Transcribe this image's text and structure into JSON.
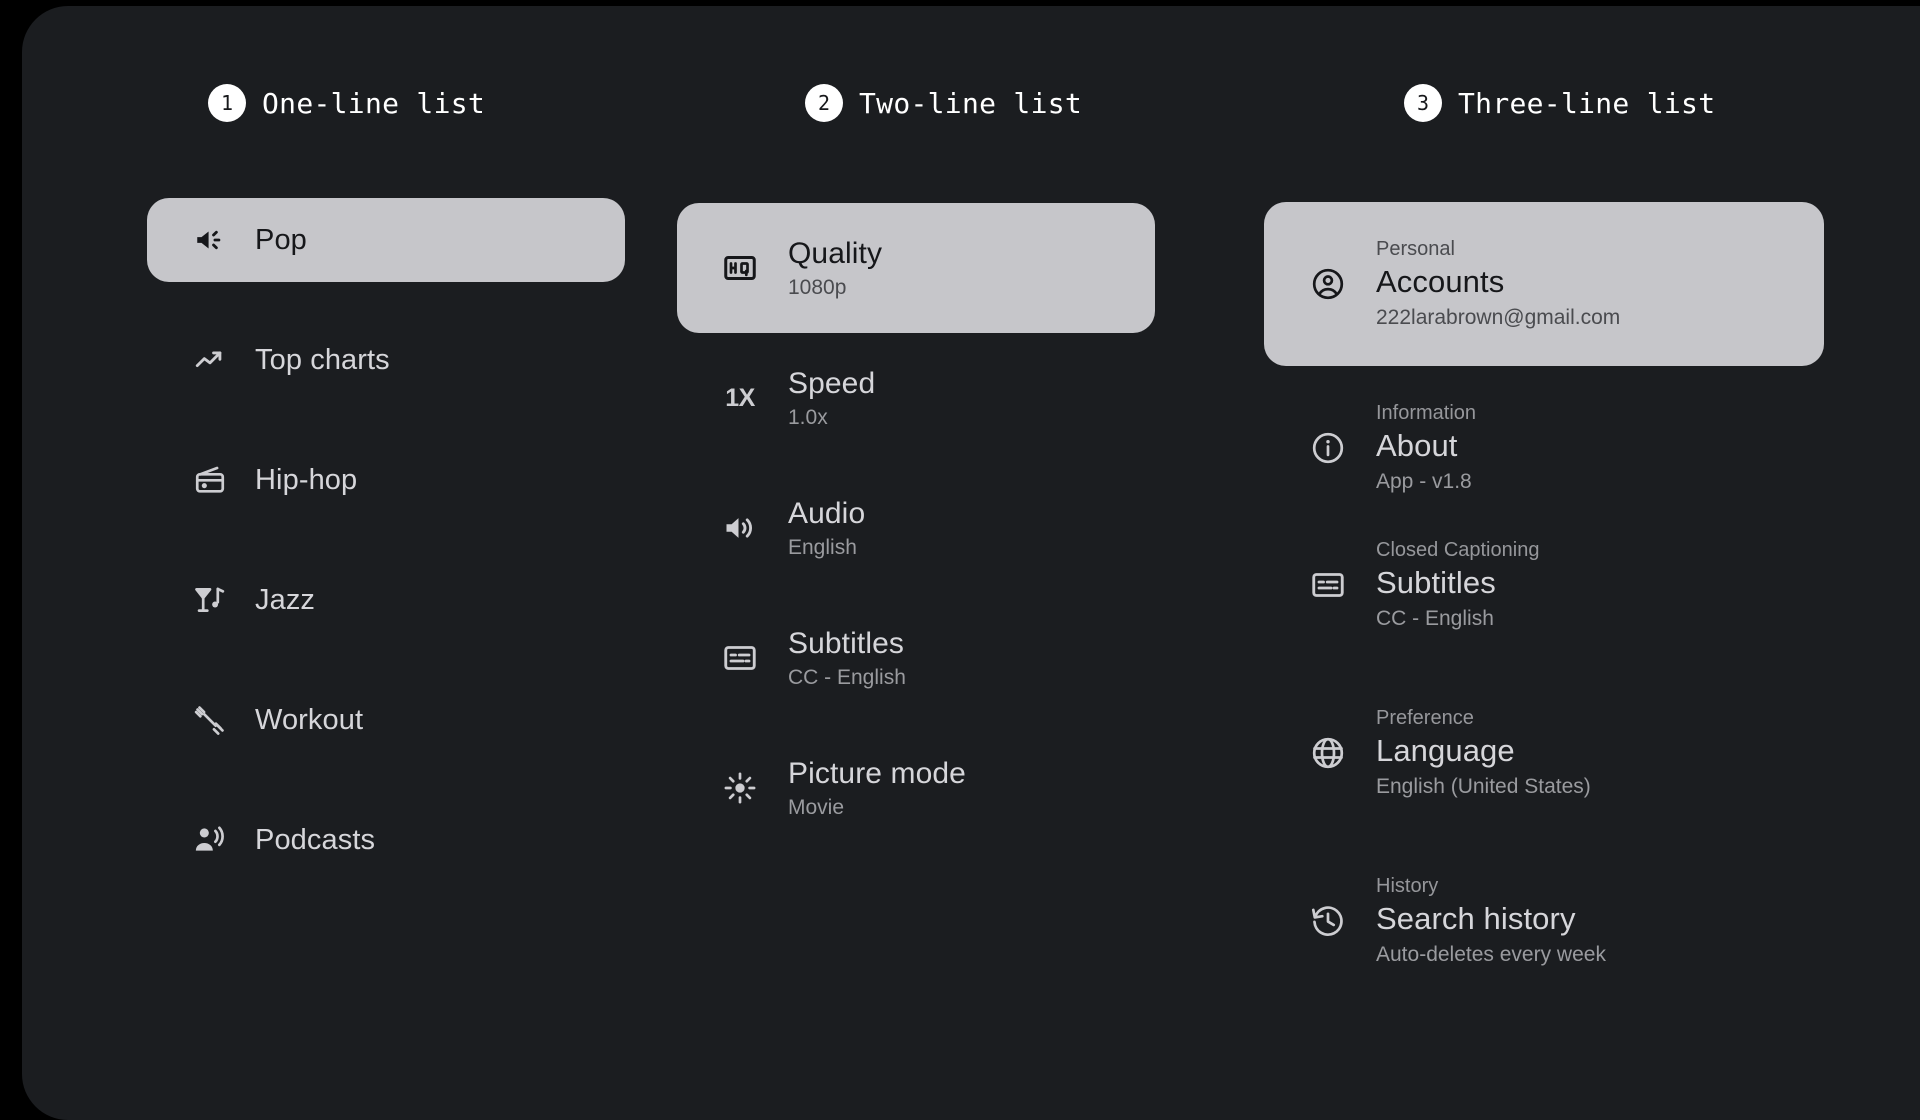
{
  "colors": {
    "page_background": "#000000",
    "surface_background": "#1b1d20",
    "selected_row_background": "#c6c6ca",
    "headline_text": "#d6d6da",
    "supporting_text": "#9a9b9f",
    "badge_background": "#ffffff"
  },
  "columns": [
    {
      "badge": "1",
      "title": "One-line list",
      "items": [
        {
          "icon": "campaign-icon",
          "headline": "Pop",
          "selected": true
        },
        {
          "icon": "trending-up-icon",
          "headline": "Top charts",
          "selected": false
        },
        {
          "icon": "radio-icon",
          "headline": "Hip-hop",
          "selected": false
        },
        {
          "icon": "nightlife-icon",
          "headline": "Jazz",
          "selected": false
        },
        {
          "icon": "fitness-icon",
          "headline": "Workout",
          "selected": false
        },
        {
          "icon": "podcasts-icon",
          "headline": "Podcasts",
          "selected": false
        }
      ]
    },
    {
      "badge": "2",
      "title": "Two-line list",
      "items": [
        {
          "icon": "hq-icon",
          "headline": "Quality",
          "support": "1080p",
          "selected": true
        },
        {
          "icon": "speed-1x-icon",
          "headline": "Speed",
          "support": "1.0x",
          "selected": false
        },
        {
          "icon": "volume-up-icon",
          "headline": "Audio",
          "support": "English",
          "selected": false
        },
        {
          "icon": "subtitles-icon",
          "headline": "Subtitles",
          "support": "CC - English",
          "selected": false
        },
        {
          "icon": "brightness-icon",
          "headline": "Picture mode",
          "support": "Movie",
          "selected": false
        }
      ]
    },
    {
      "badge": "3",
      "title": "Three-line list",
      "items": [
        {
          "icon": "account-circle-icon",
          "over": "Personal",
          "headline": "Accounts",
          "support": "222larabrown@gmail.com",
          "selected": true
        },
        {
          "icon": "info-icon",
          "over": "Information",
          "headline": "About",
          "support": "App - v1.8",
          "selected": false
        },
        {
          "icon": "subtitles-icon",
          "over": "Closed Captioning",
          "headline": "Subtitles",
          "support": "CC - English",
          "selected": false
        },
        {
          "icon": "language-icon",
          "over": "Preference",
          "headline": "Language",
          "support": "English (United States)",
          "selected": false
        },
        {
          "icon": "history-icon",
          "over": "History",
          "headline": "Search history",
          "support": "Auto-deletes every week",
          "selected": false
        }
      ]
    }
  ]
}
